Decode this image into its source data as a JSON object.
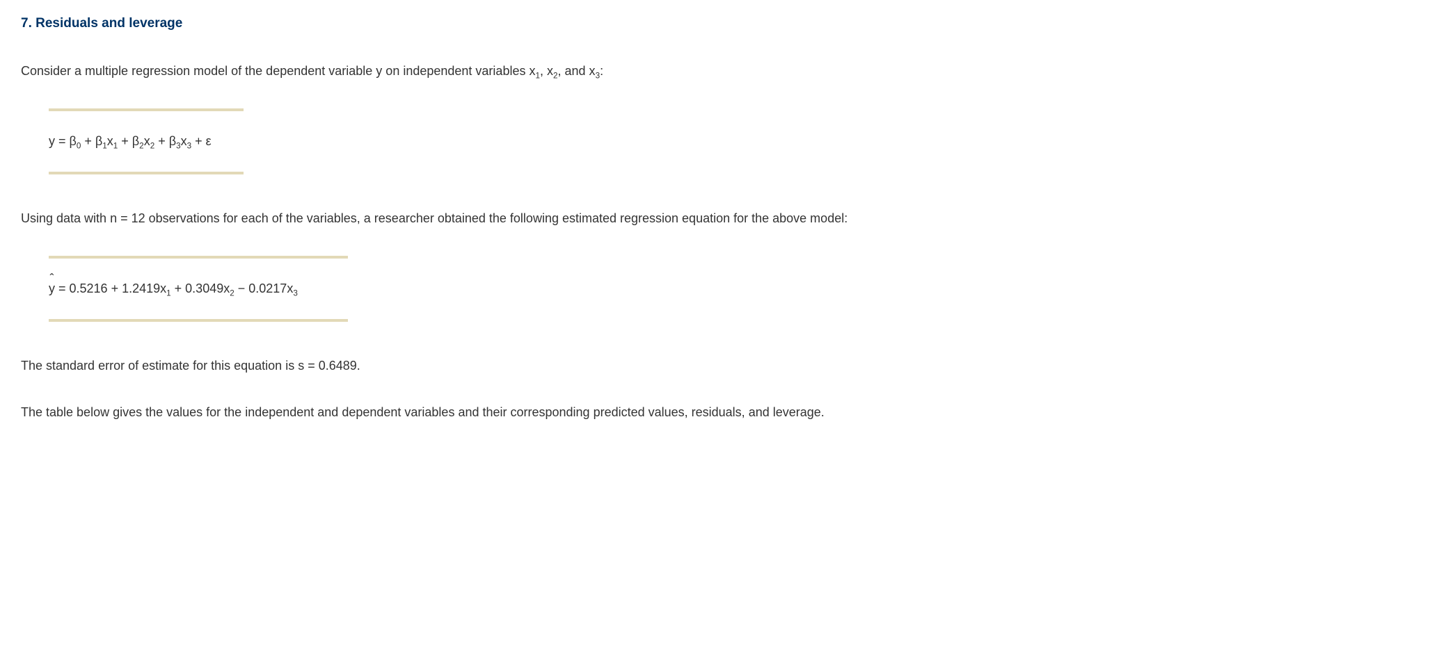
{
  "heading": "7. Residuals and leverage",
  "intro_prefix": "Consider a multiple regression model of the dependent variable y on independent variables x",
  "intro_mid1": ", x",
  "intro_mid2": ", and x",
  "intro_suffix": ":",
  "eq1": {
    "a": "y = β",
    "b": " + β",
    "c": "x",
    "d": " + β",
    "e": "x",
    "f": " + β",
    "g": "x",
    "h": " + ε"
  },
  "para2": "Using data with n = 12 observations for each of the variables, a researcher obtained the following estimated regression equation for the above model:",
  "eq2": {
    "a": "y",
    "b": " = 0.5216 + 1.2419x",
    "c": " + 0.3049x",
    "d": " − 0.0217x"
  },
  "para3": "The standard error of estimate for this equation is s = 0.6489.",
  "para4": "The table below gives the values for the independent and dependent variables and their corresponding predicted values, residuals, and leverage.",
  "sub": {
    "s0": "0",
    "s1": "1",
    "s2": "2",
    "s3": "3"
  }
}
